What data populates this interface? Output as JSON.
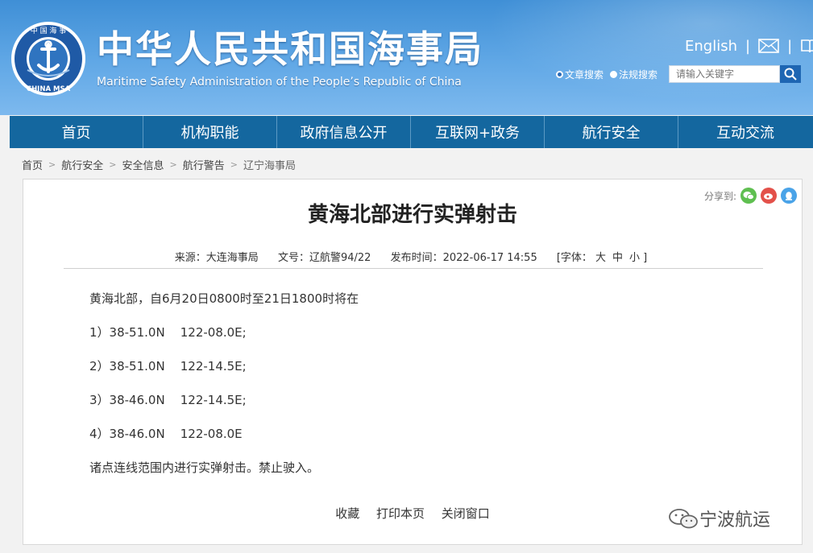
{
  "header": {
    "seal_text_top": "中 国 海 事",
    "seal_text_bottom": "CHINA MSA",
    "title_cn": "中华人民共和国海事局",
    "title_en": "Maritime Safety Administration of the People’s Republic of China",
    "english_link": "English",
    "sep": "|",
    "search": {
      "option1": "文章搜索",
      "option2": "法规搜索",
      "placeholder": "请输入关键字"
    }
  },
  "nav": {
    "items": [
      "首页",
      "机构职能",
      "政府信息公开",
      "互联网+政务",
      "航行安全",
      "互动交流"
    ]
  },
  "breadcrumb": {
    "items": [
      "首页",
      "航行安全",
      "安全信息",
      "航行警告",
      "辽宁海事局"
    ]
  },
  "article": {
    "share_label": "分享到:",
    "title": "黄海北部进行实弹射击",
    "source": "来源：大连海事局",
    "doc_no": "文号：辽航警94/22",
    "publish_time": "发布时间：2022-06-17 14:55",
    "font_label": "[字体：",
    "font_large": "大",
    "font_mid": "中",
    "font_small": "小 ]",
    "lines": [
      "黄海北部，自6月20日0800时至21日1800时将在",
      "1）38-51.0N    122-08.0E;",
      "2）38-51.0N    122-14.5E;",
      "3）38-46.0N    122-14.5E;",
      "4）38-46.0N    122-08.0E",
      "诸点连线范围内进行实弹射击。禁止驶入。"
    ],
    "actions": [
      "收藏",
      "打印本页",
      "关闭窗口"
    ]
  },
  "watermark": {
    "text": "宁波航运"
  },
  "colors": {
    "nav_bg": "#14679f",
    "header_top": "#3f8fd6",
    "header_bottom": "#7db9ee"
  }
}
